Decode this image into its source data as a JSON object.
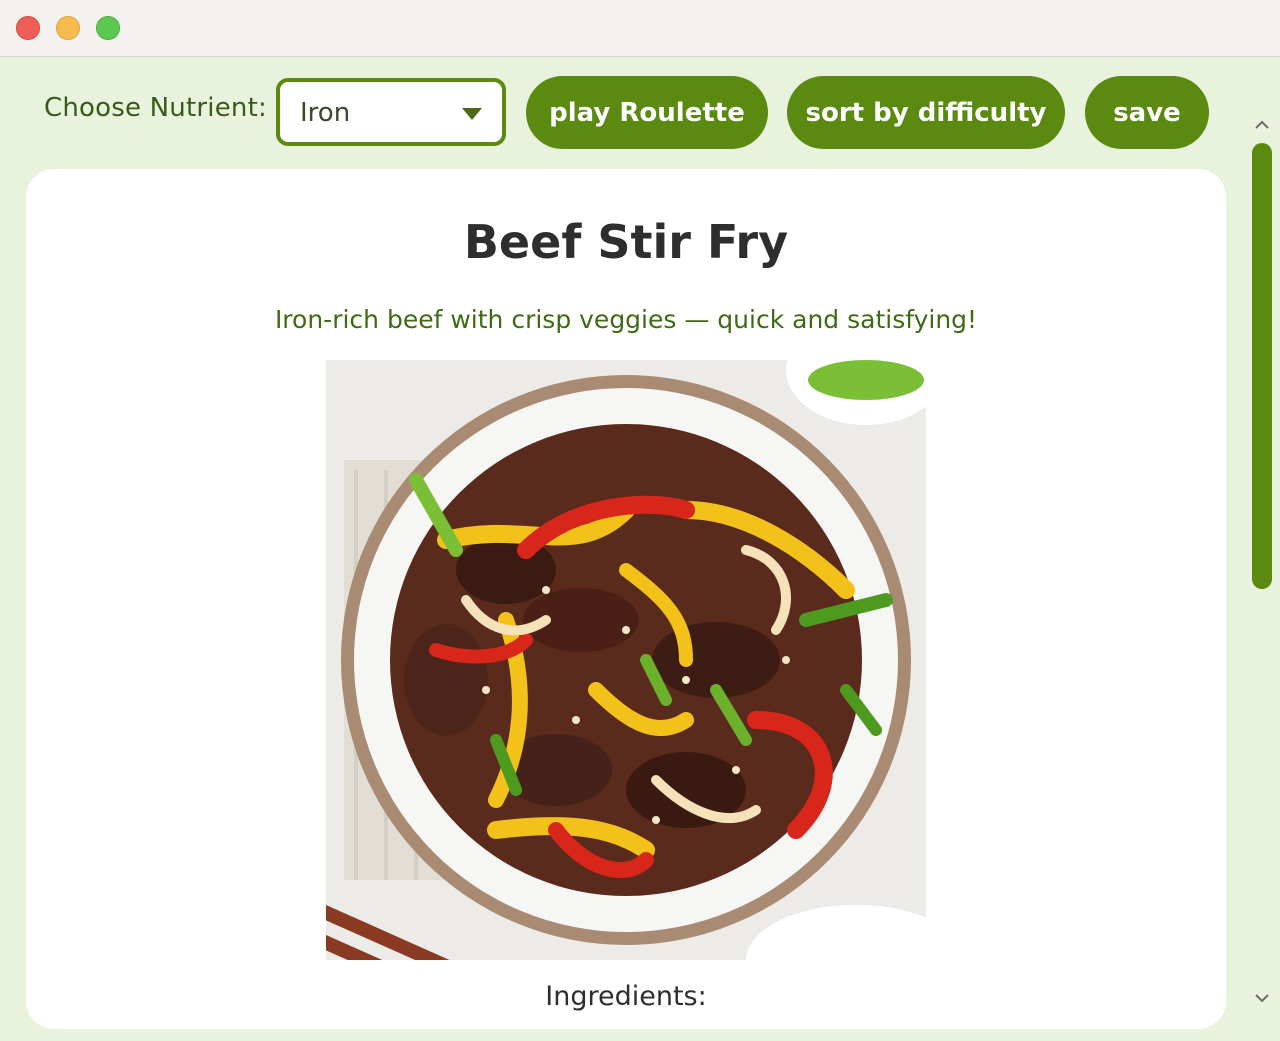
{
  "window": {
    "controls": [
      "close",
      "minimize",
      "zoom"
    ]
  },
  "toolbar": {
    "nutrient_label": "Choose Nutrient:",
    "nutrient_selected": "Iron",
    "roulette_label": "play Roulette",
    "sort_label": "sort by difficulty",
    "save_label": "save"
  },
  "recipe": {
    "title": "Beef Stir Fry",
    "subtitle": "Iron-rich beef with crisp veggies — quick and satisfying!",
    "ingredients_heading": "Ingredients:"
  },
  "colors": {
    "accent": "#5a8a0f",
    "background": "#e9f2dc",
    "subtitle": "#3f6b14"
  },
  "icons": {
    "dropdown": "chevron-down-icon",
    "scroll_up": "scroll-up-icon",
    "scroll_down": "scroll-down-icon"
  }
}
